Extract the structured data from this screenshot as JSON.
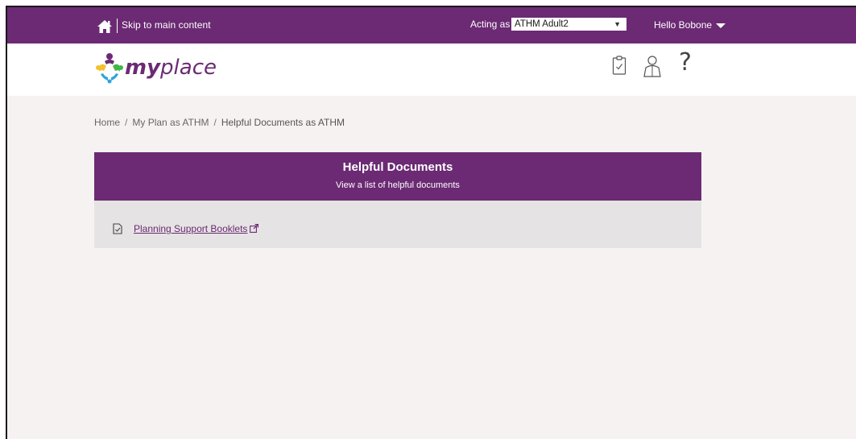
{
  "topbar": {
    "skip_label": "Skip to main content",
    "acting_label": "Acting as",
    "acting_value": "ATHM Adult2",
    "hello_label": "Hello Bobone"
  },
  "header": {
    "logo_my": "my",
    "logo_place": "place",
    "help_glyph": "?",
    "icons": [
      "clipboard-check-icon",
      "person-icon",
      "help-icon"
    ]
  },
  "breadcrumb": {
    "items": [
      "Home",
      "My Plan as ATHM",
      "Helpful Documents as ATHM"
    ],
    "separator": "/"
  },
  "panel": {
    "title": "Helpful Documents",
    "subtitle": "View a list of helpful documents",
    "documents": [
      {
        "label": "Planning Support Booklets",
        "icon": "document-icon",
        "external": true
      }
    ]
  },
  "colors": {
    "brand_purple": "#6b2a73",
    "page_bg": "#f6f2f2",
    "panel_body_bg": "#e5e3e3"
  }
}
